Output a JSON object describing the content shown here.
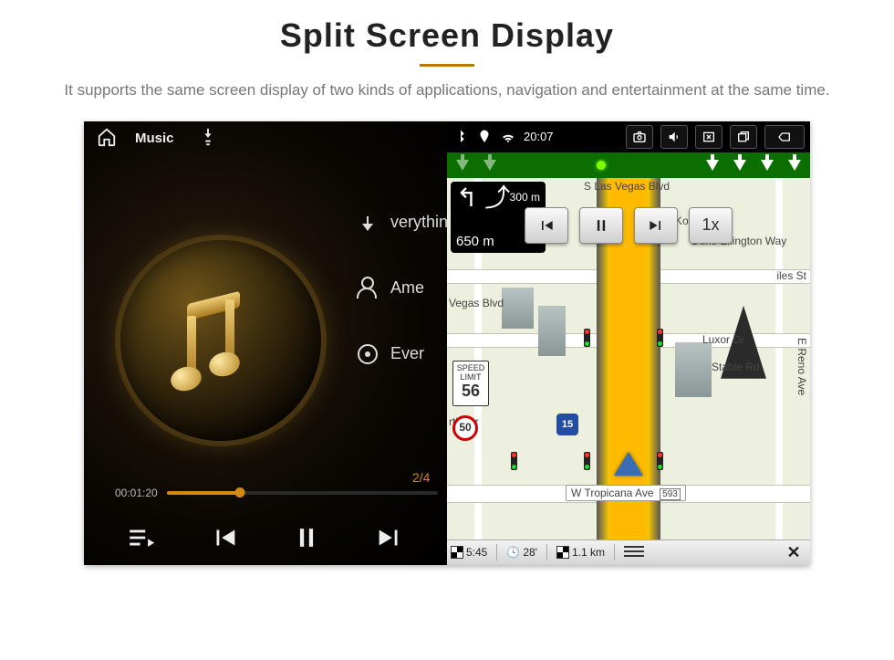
{
  "page": {
    "title": "Split Screen Display",
    "subtitle": "It supports the same screen display of two kinds of applications, navigation and entertainment at the same time."
  },
  "music": {
    "status": {
      "app_label": "Music"
    },
    "tracks": {
      "t1": "verythin",
      "t2": "Ame",
      "t3": "Ever"
    },
    "counter": "2/4",
    "elapsed": "00:01:20",
    "progress_pct": 27
  },
  "nav": {
    "status": {
      "time": "20:07"
    },
    "turn": {
      "dist1": "300 m",
      "dist2": "650 m"
    },
    "streets": {
      "lasvegas": "S Las Vegas Blvd",
      "koval": "Koval Ln",
      "duke": "Duke Ellington Way",
      "iles": "iles St",
      "vegas2": "Vegas Blvd",
      "luxor": "Luxor Dr",
      "stable": "Stable Rd",
      "reno": "E Reno Ave",
      "tropicana": "W Tropicana Ave",
      "trop_exit": "593",
      "rtin": "rtin Dr"
    },
    "controls": {
      "speed": "1x"
    },
    "speed_limit": {
      "label": "SPEED LIMIT",
      "value": "56",
      "circle": "50"
    },
    "shield": "15",
    "footer": {
      "eta": "5:45",
      "time_remaining": "28'",
      "distance": "1.1 km"
    }
  }
}
